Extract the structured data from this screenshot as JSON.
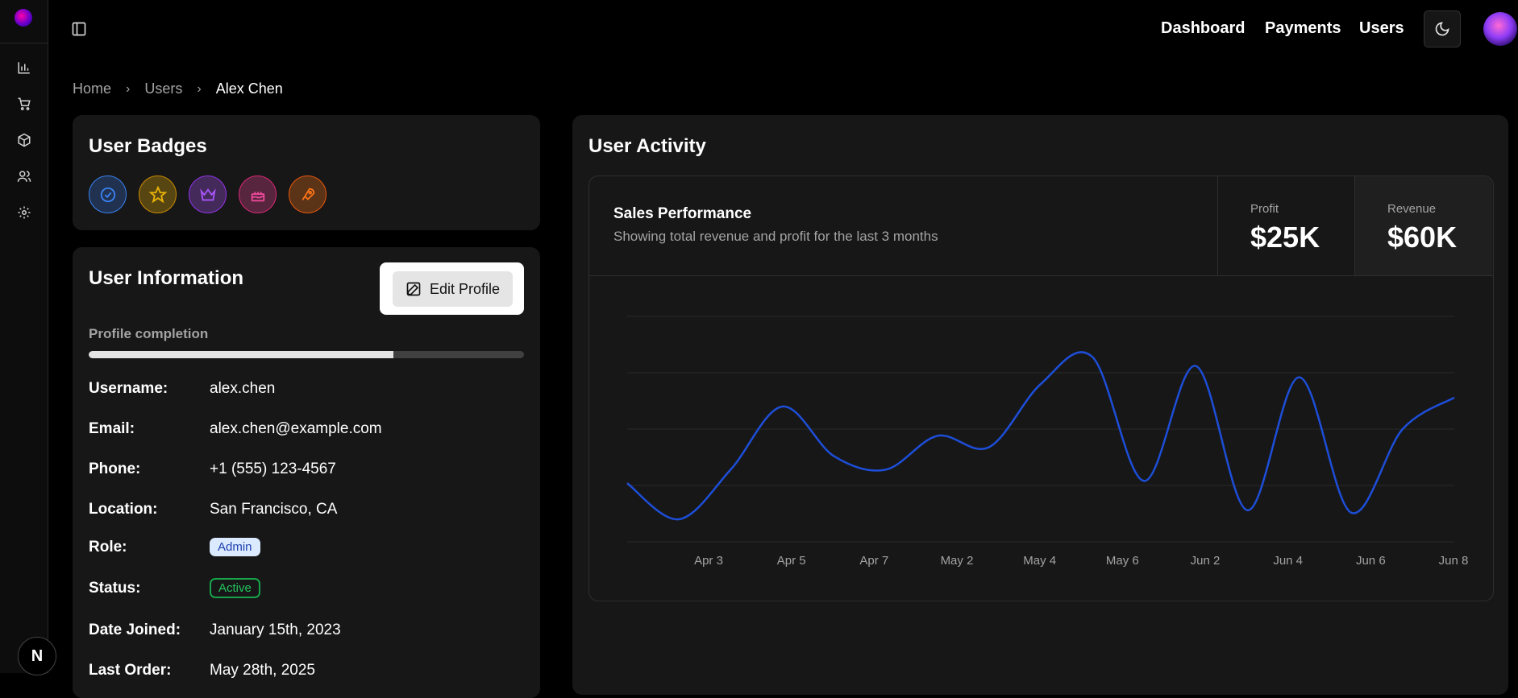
{
  "app": {
    "logo_icon": "brain-logo-icon"
  },
  "sidebar": {
    "items": [
      {
        "icon": "bar-chart-icon",
        "label": "Analytics"
      },
      {
        "icon": "cart-icon",
        "label": "Orders"
      },
      {
        "icon": "package-icon",
        "label": "Products"
      },
      {
        "icon": "users-icon",
        "label": "Users"
      },
      {
        "icon": "gear-icon",
        "label": "Settings"
      }
    ],
    "footer_badge": "N"
  },
  "header": {
    "nav": [
      "Dashboard",
      "Payments",
      "Users"
    ],
    "theme_icon": "moon-icon"
  },
  "breadcrumb": [
    "Home",
    "Users",
    "Alex Chen"
  ],
  "badges_card": {
    "title": "User Badges",
    "badges": [
      {
        "icon": "verified-icon",
        "color": "#3b82f6"
      },
      {
        "icon": "star-icon",
        "color": "#eab308"
      },
      {
        "icon": "crown-icon",
        "color": "#a855f7"
      },
      {
        "icon": "cake-icon",
        "color": "#ec4899"
      },
      {
        "icon": "rocket-icon",
        "color": "#f97316"
      }
    ]
  },
  "info_card": {
    "title": "User Information",
    "edit_label": "Edit Profile",
    "progress_label": "Profile completion",
    "progress_percent": 70,
    "rows": [
      {
        "key": "Username:",
        "value": "alex.chen"
      },
      {
        "key": "Email:",
        "value": "alex.chen@example.com"
      },
      {
        "key": "Phone:",
        "value": "+1 (555) 123-4567"
      },
      {
        "key": "Location:",
        "value": "San Francisco, CA"
      },
      {
        "key": "Role:",
        "value": "Admin"
      },
      {
        "key": "Status:",
        "value": "Active"
      },
      {
        "key": "Date Joined:",
        "value": "January 15th, 2023"
      },
      {
        "key": "Last Order:",
        "value": "May 28th, 2025"
      }
    ]
  },
  "activity": {
    "title": "User Activity",
    "sales_title": "Sales Performance",
    "sales_subtitle": "Showing total revenue and profit for the last 3 months",
    "profit_label": "Profit",
    "profit_value": "$25K",
    "revenue_label": "Revenue",
    "revenue_value": "$60K"
  },
  "chart_data": {
    "type": "line",
    "x": [
      "Apr 3",
      "Apr 5",
      "Apr 7",
      "May 2",
      "May 4",
      "May 6",
      "Jun 2",
      "Jun 4",
      "Jun 6",
      "Jun 8"
    ],
    "series": [
      {
        "color": "#1d4ed8",
        "values": [
          0.26,
          0.1,
          0.32,
          0.6,
          0.38,
          0.32,
          0.47,
          0.42,
          0.7,
          0.82,
          0.27,
          0.78,
          0.14,
          0.73,
          0.13,
          0.5,
          0.64
        ]
      }
    ],
    "tick_labels": [
      "Apr 3",
      "Apr 5",
      "Apr 7",
      "May 2",
      "May 4",
      "May 6",
      "Jun 2",
      "Jun 4",
      "Jun 6",
      "Jun 8"
    ],
    "grid": true,
    "ylim": [
      0,
      1
    ]
  }
}
